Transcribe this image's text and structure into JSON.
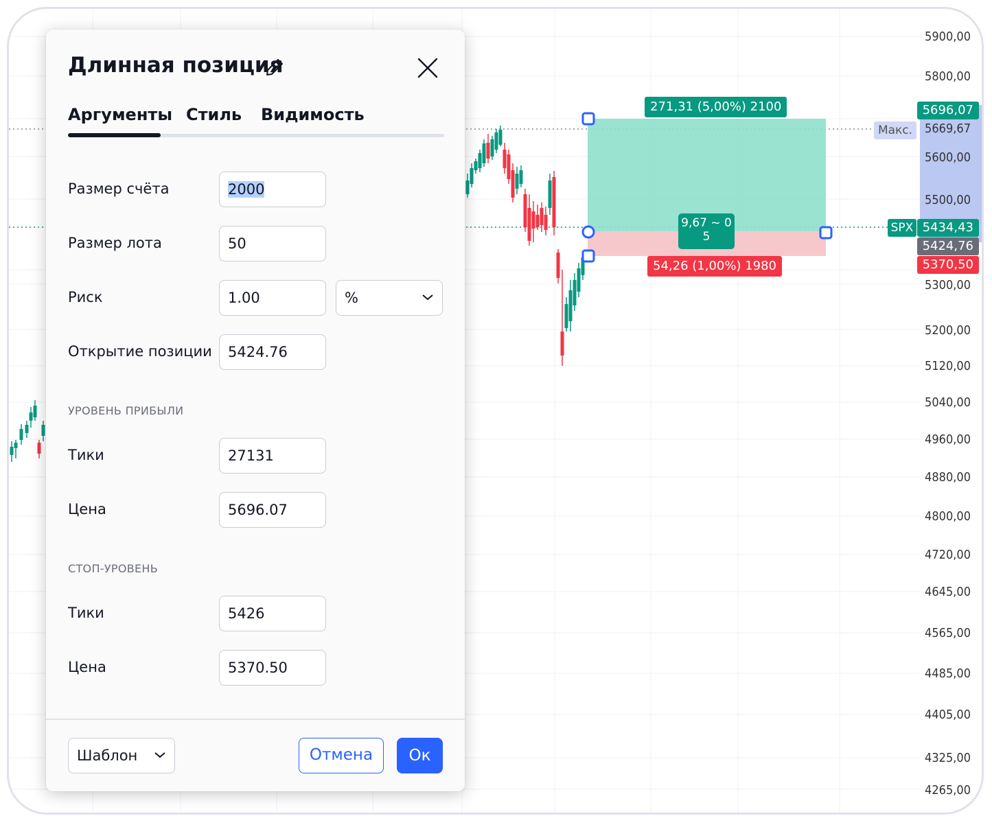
{
  "dialog": {
    "title": "Длинная позиция",
    "tabs": [
      {
        "label": "Аргументы",
        "active": true
      },
      {
        "label": "Стиль",
        "active": false
      },
      {
        "label": "Видимость",
        "active": false
      }
    ],
    "fields": {
      "account_size": {
        "label": "Размер счёта",
        "value": "2000"
      },
      "lot_size": {
        "label": "Размер лота",
        "value": "50"
      },
      "risk": {
        "label": "Риск",
        "value": "1.00",
        "unit": "%"
      },
      "entry": {
        "label": "Открытие позиции",
        "value": "5424.76"
      }
    },
    "profit_section": {
      "title": "УРОВЕНЬ ПРИБЫЛИ",
      "ticks": {
        "label": "Тики",
        "value": "27131"
      },
      "price": {
        "label": "Цена",
        "value": "5696.07"
      }
    },
    "stop_section": {
      "title": "СТОП-УРОВЕНЬ",
      "ticks": {
        "label": "Тики",
        "value": "5426"
      },
      "price": {
        "label": "Цена",
        "value": "5370.50"
      }
    },
    "footer": {
      "template_label": "Шаблон",
      "cancel_label": "Отмена",
      "ok_label": "Ок"
    }
  },
  "chart": {
    "price_axis": [
      "5900,00",
      "5800,00",
      "5600,00",
      "5500,00",
      "5300,00",
      "5200,00",
      "5120,00",
      "5040,00",
      "4960,00",
      "4880,00",
      "4800,00",
      "4720,00",
      "4645,00",
      "4565,00",
      "4485,00",
      "4405,00",
      "4325,00",
      "4265,00"
    ],
    "axis_tags": {
      "target": "5696,07",
      "high_label": "Макс.",
      "high": "5669,67",
      "symbol": "SPX",
      "last": "5434,43",
      "entry": "5424,76",
      "stop": "5370,50"
    },
    "position": {
      "target_label": "271,31 (5,00%) 2100",
      "center_label_line1": "9,67 ~ 0",
      "center_label_line2": "5",
      "stop_label": "54,26 (1,00%) 1980"
    },
    "colors": {
      "profit_zone": "#8fe0cc",
      "loss_zone": "#f6c4c8",
      "profit_tag": "#089981",
      "loss_tag": "#f23645",
      "handle": "#2962ff",
      "up_candle": "#089981",
      "down_candle": "#f23645",
      "axis_highlight": "#aebef0"
    }
  }
}
